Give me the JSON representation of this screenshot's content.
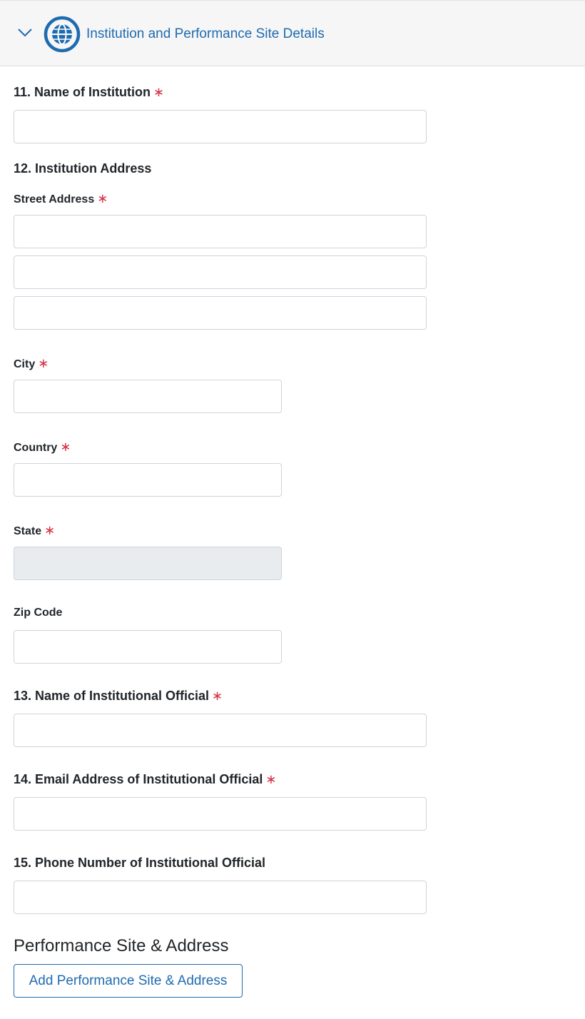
{
  "section": {
    "title": "Institution and Performance Site Details",
    "expanded": true,
    "icons": {
      "toggle": "chevron-down-icon",
      "section": "globe-icon"
    },
    "accent_color": "#1f6bb0"
  },
  "form": {
    "required_marker": "∗",
    "institution_name": {
      "label": "11. Name of Institution",
      "required": true,
      "value": ""
    },
    "institution_address": {
      "label": "12. Institution Address",
      "street": {
        "label": "Street Address",
        "required": true,
        "values": [
          "",
          "",
          ""
        ]
      },
      "city": {
        "label": "City",
        "required": true,
        "value": ""
      },
      "country": {
        "label": "Country",
        "required": true,
        "value": ""
      },
      "state": {
        "label": "State",
        "required": true,
        "value": "",
        "disabled": true
      },
      "zip": {
        "label": "Zip Code",
        "required": false,
        "value": ""
      }
    },
    "official_name": {
      "label": "13. Name of Institutional Official",
      "required": true,
      "value": ""
    },
    "official_email": {
      "label": "14. Email Address of Institutional Official",
      "required": true,
      "value": ""
    },
    "official_phone": {
      "label": "15. Phone Number of Institutional Official",
      "required": false,
      "value": ""
    }
  },
  "performance_site": {
    "title": "Performance Site & Address",
    "add_button_label": "Add Performance Site & Address"
  }
}
